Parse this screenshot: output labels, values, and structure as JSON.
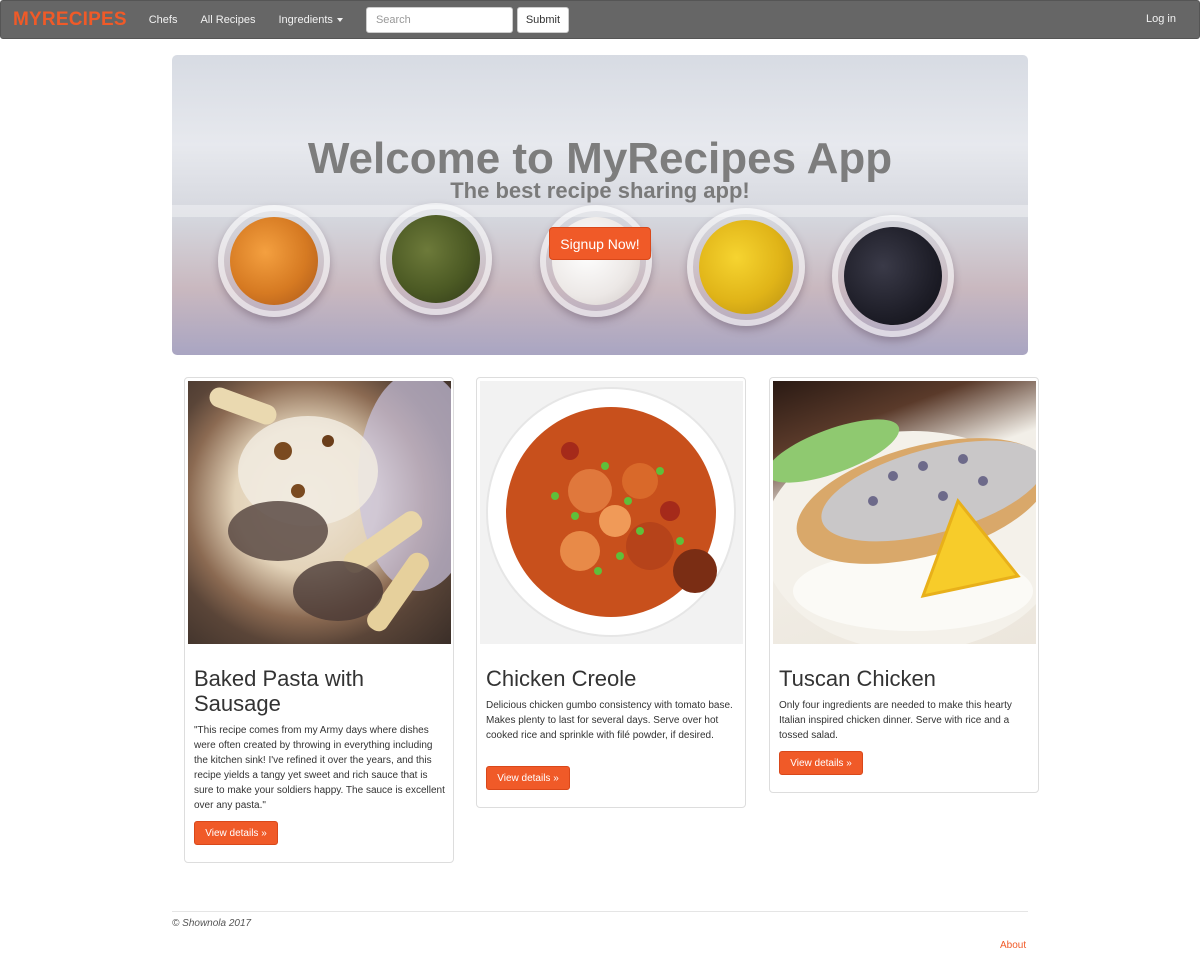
{
  "navbar": {
    "brand": "MYRECIPES",
    "links": [
      "Chefs",
      "All Recipes",
      "Ingredients"
    ],
    "search_placeholder": "Search",
    "submit_label": "Submit",
    "login_label": "Log in"
  },
  "hero": {
    "title": "Welcome to MyRecipes App",
    "subtitle": "The best recipe sharing app!",
    "signup_label": "Signup Now!"
  },
  "recipes": [
    {
      "title": "Baked Pasta with Sausage",
      "description": "\"This recipe comes from my Army days where dishes were often created by throwing in everything including the kitchen sink! I've refined it over the years, and this recipe yields a tangy yet sweet and rich sauce that is sure to make your soldiers happy. The sauce is excellent over any pasta.\"",
      "button": "View details »"
    },
    {
      "title": "Chicken Creole",
      "description": "Delicious chicken gumbo consistency with tomato base. Makes plenty to last for several days. Serve over hot cooked rice and sprinkle with filé powder, if desired.",
      "button": "View details »"
    },
    {
      "title": "Tuscan Chicken",
      "description": "Only four ingredients are needed to make this hearty Italian inspired chicken dinner. Serve with rice and a tossed salad.",
      "button": "View details »"
    }
  ],
  "footer": {
    "copyright": "© Shownola 2017",
    "about": "About"
  },
  "colors": {
    "accent": "#f05a28",
    "navbar": "#666666"
  }
}
